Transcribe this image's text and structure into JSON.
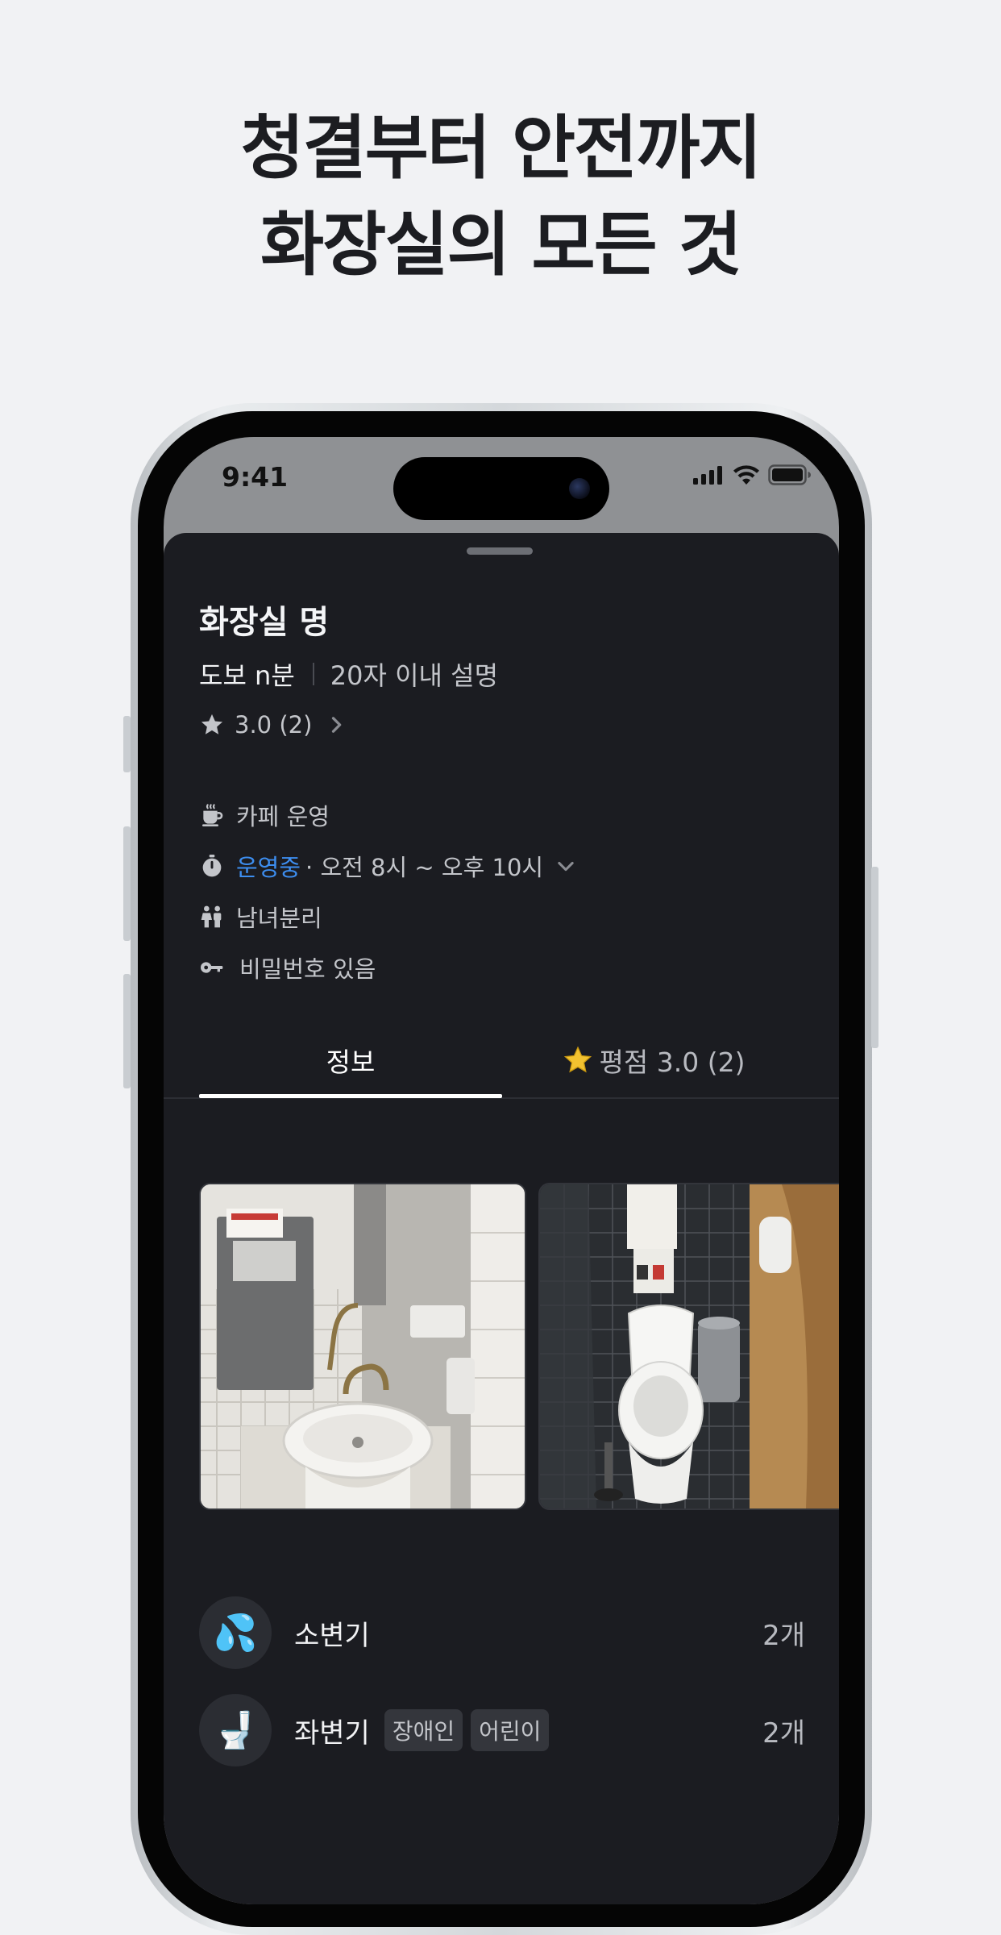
{
  "headline": {
    "line1": "청결부터 안전까지",
    "line2": "화장실의 모든 것"
  },
  "status_bar": {
    "time": "9:41"
  },
  "sheet": {
    "title": "화장실 명",
    "walk_time": "도보 n분",
    "short_desc": "20자 이내 설명",
    "rating_text": "3.0 (2)",
    "info": {
      "operator": "카페 운영",
      "open_status": "운영중",
      "hours": "· 오전 8시 ~ 오후 10시",
      "gender": "남녀분리",
      "password": "비밀번호 있음"
    },
    "tabs": {
      "info": "정보",
      "rating": "평점 3.0 (2)"
    },
    "facilities": [
      {
        "name": "소변기",
        "count": "2개",
        "icon": "💦",
        "tags": []
      },
      {
        "name": "좌변기",
        "count": "2개",
        "icon": "🚽",
        "tags": [
          "장애인",
          "어린이"
        ]
      }
    ]
  },
  "colors": {
    "sheet_bg": "#1b1c21",
    "open_status": "#3d8ef0",
    "page_bg": "#f1f2f4"
  }
}
